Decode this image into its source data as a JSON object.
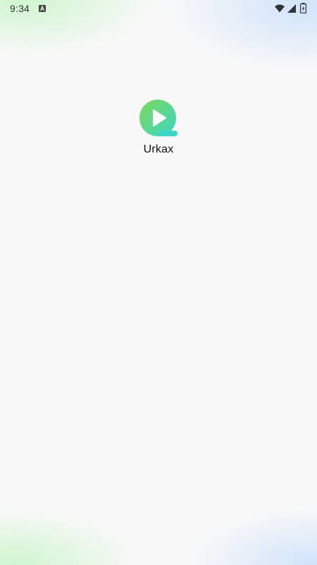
{
  "status_bar": {
    "time": "9:34",
    "notification_icon": "text-a-icon",
    "wifi_icon": "wifi-icon",
    "signal_icon": "cellular-signal-icon",
    "battery_icon": "battery-charging-icon"
  },
  "splash": {
    "app_name": "Urkax",
    "logo_icon": "play-logo-icon",
    "colors": {
      "logo_gradient_start": "#7ed957",
      "logo_gradient_end": "#3bd6c6",
      "background": "#f8f8f8",
      "glow_green": "#c8f5c8",
      "glow_blue": "#cde1fa"
    }
  }
}
